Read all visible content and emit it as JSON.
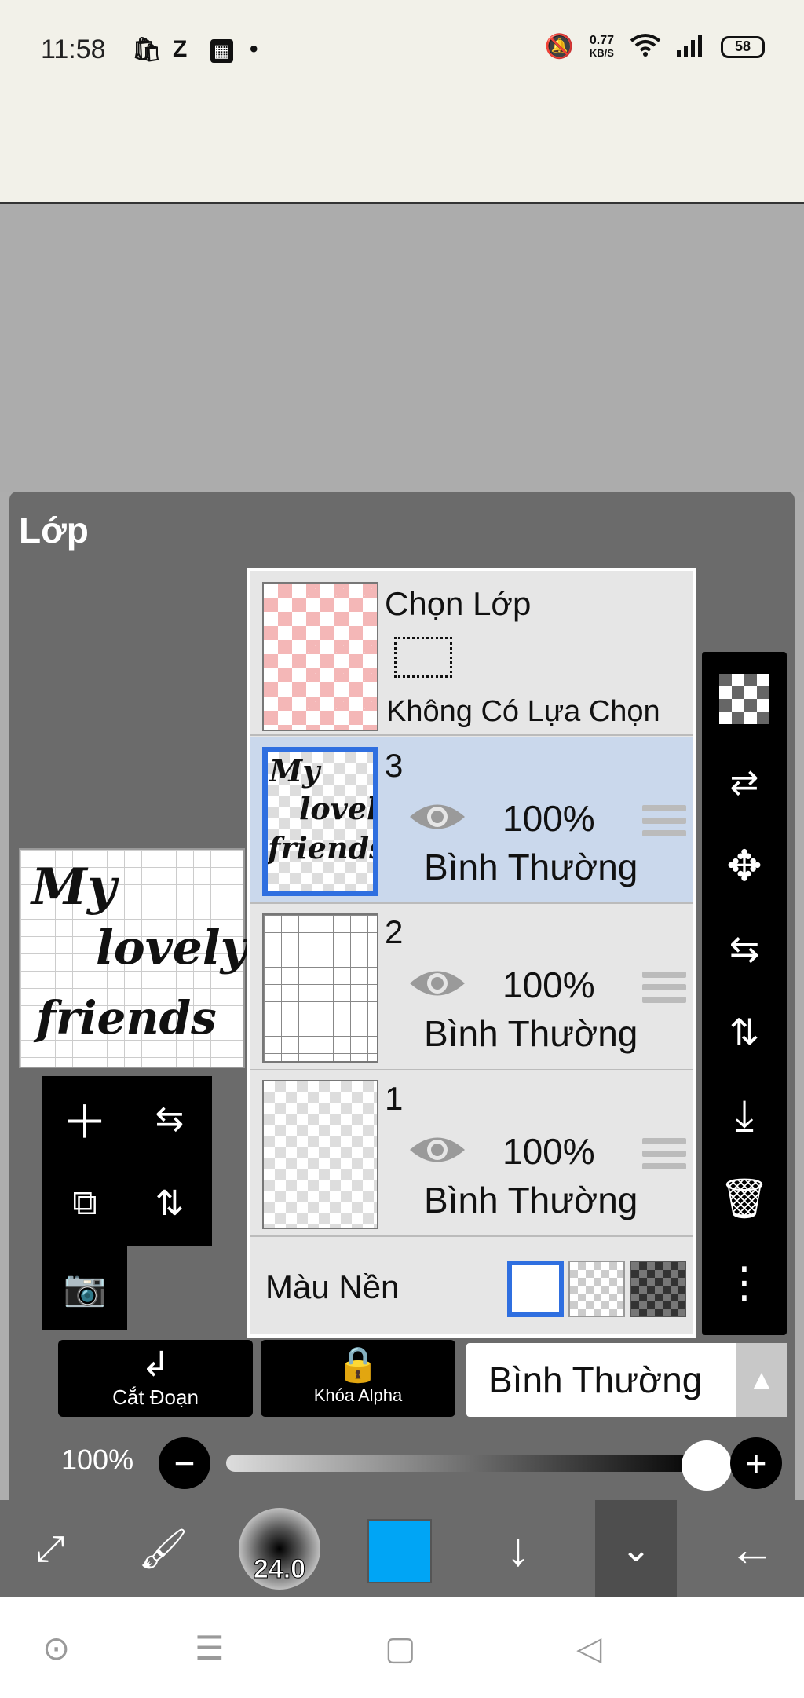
{
  "status_bar": {
    "time": "11:58",
    "icons": [
      "shopping-bag-icon",
      "zalo-icon",
      "news-icon"
    ],
    "speed_value": "0.77",
    "speed_unit": "KB/S",
    "battery": "58"
  },
  "panel": {
    "title": "Lớp"
  },
  "preview": {
    "line1": "My",
    "line2": "lovely",
    "line3": "friends"
  },
  "selection_layer": {
    "title": "Chọn Lớp",
    "subtitle": "Không Có Lựa Chọn"
  },
  "layers": [
    {
      "number": "3",
      "opacity": "100%",
      "blend": "Bình Thường",
      "selected": true,
      "thumb": "text"
    },
    {
      "number": "2",
      "opacity": "100%",
      "blend": "Bình Thường",
      "selected": false,
      "thumb": "grid"
    },
    {
      "number": "1",
      "opacity": "100%",
      "blend": "Bình Thường",
      "selected": false,
      "thumb": "empty"
    }
  ],
  "background": {
    "label": "Màu Nền",
    "options": [
      "white",
      "transparent",
      "dark"
    ],
    "selected": "white"
  },
  "actions": {
    "clip_label": "Cắt Đoạn",
    "alpha_lock_label": "Khóa Alpha",
    "blend_mode": "Bình Thường"
  },
  "opacity": {
    "label": "100%",
    "value": 1.0
  },
  "bottom_tools": {
    "brush_size": "24.0",
    "color": "#00A5F5"
  }
}
